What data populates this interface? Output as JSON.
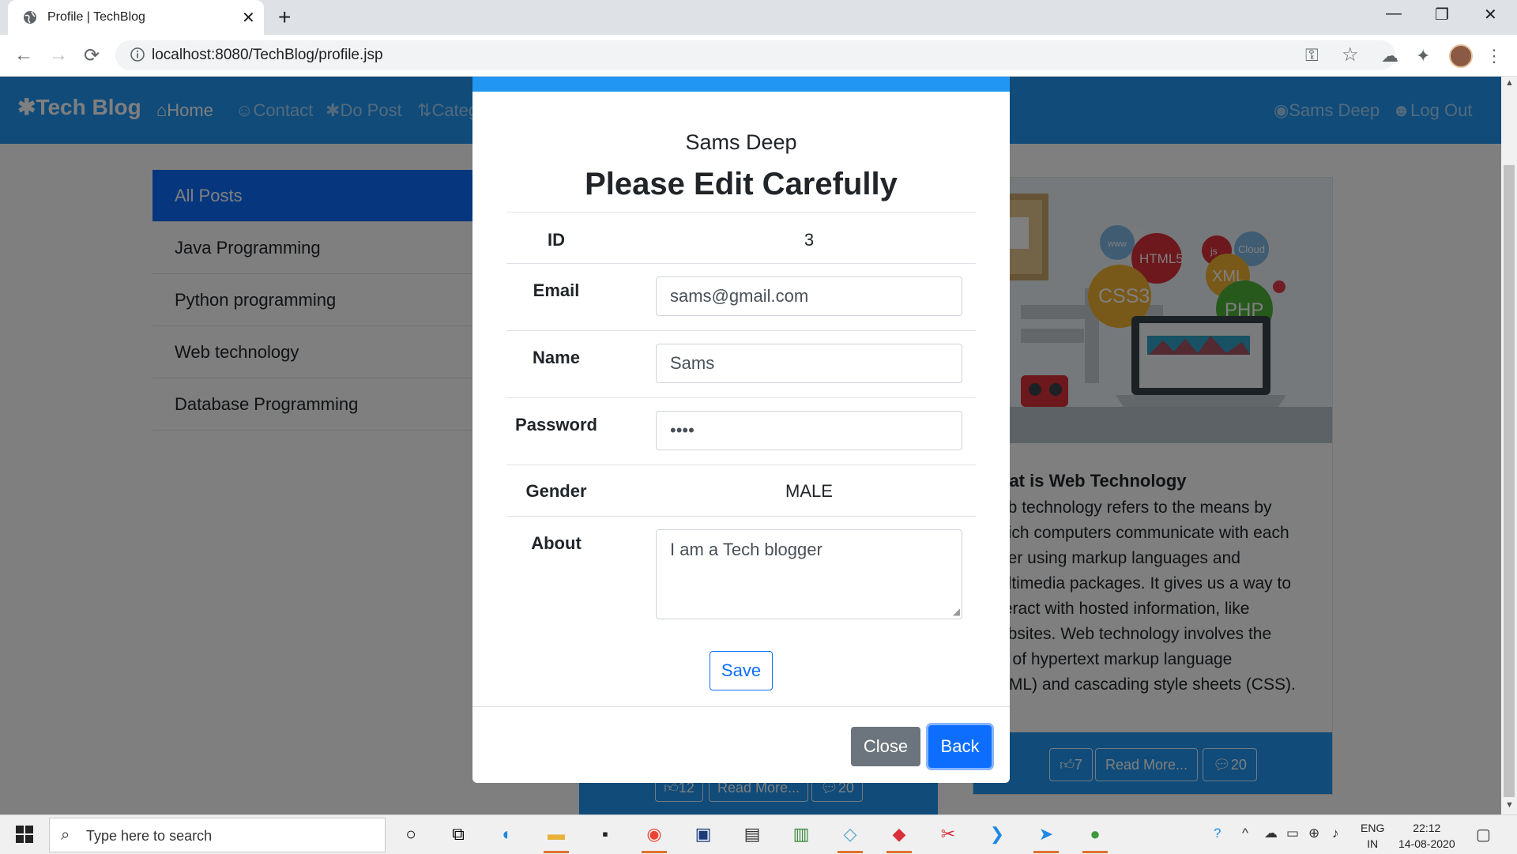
{
  "browser": {
    "tab_title": "Profile | TechBlog",
    "tab_close": "✕",
    "new_tab": "+",
    "url": "localhost:8080/TechBlog/profile.jsp",
    "win_min": "—",
    "win_max": "❐",
    "win_close": "✕"
  },
  "navbar": {
    "brand": "✱Tech Blog",
    "links": [
      "Home",
      "Contact",
      "Do Post",
      "Categ"
    ],
    "right_links": [
      "Sams Deep",
      "Log Out"
    ]
  },
  "sidebar": {
    "items": [
      "All Posts",
      "Java Programming",
      "Python programming",
      "Web technology",
      "Database Programming"
    ]
  },
  "post_card": {
    "image_words": [
      "HTML5",
      "CSS3",
      "XML",
      "PHP",
      "js",
      "Cloud",
      "www"
    ],
    "title_fragment": "hat is Web Technology",
    "text_lines": [
      "eb technology refers to the means by",
      "hich computers communicate with each",
      "her using markup languages and",
      "ultimedia packages. It gives us a way to",
      "teract with hosted information, like",
      "ebsites. Web technology involves the",
      "e of hypertext markup language",
      "TML) and cascading style sheets (CSS)."
    ],
    "likes": "7",
    "read_more": "Read More...",
    "comments": "20"
  },
  "post_card_2": {
    "likes": "12",
    "read_more": "Read More...",
    "comments": "20"
  },
  "modal": {
    "user_name": "Sams Deep",
    "heading": "Please Edit Carefully",
    "id_label": "ID",
    "id_value": "3",
    "email_label": "Email",
    "email_value": "sams@gmail.com",
    "name_label": "Name",
    "name_value": "Sams",
    "password_label": "Password",
    "password_value": "••••",
    "gender_label": "Gender",
    "gender_value": "MALE",
    "about_label": "About",
    "about_value": "I am a Tech blogger",
    "save_label": "Save",
    "close_label": "Close",
    "back_label": "Back"
  },
  "taskbar": {
    "search_placeholder": "Type here to search",
    "lang_top": "ENG",
    "lang_bottom": "IN",
    "time": "22:12",
    "date": "14-08-2020"
  },
  "colors": {
    "primary": "#2196f3",
    "bootstrap_blue": "#0d6efd",
    "secondary": "#6c757d"
  }
}
